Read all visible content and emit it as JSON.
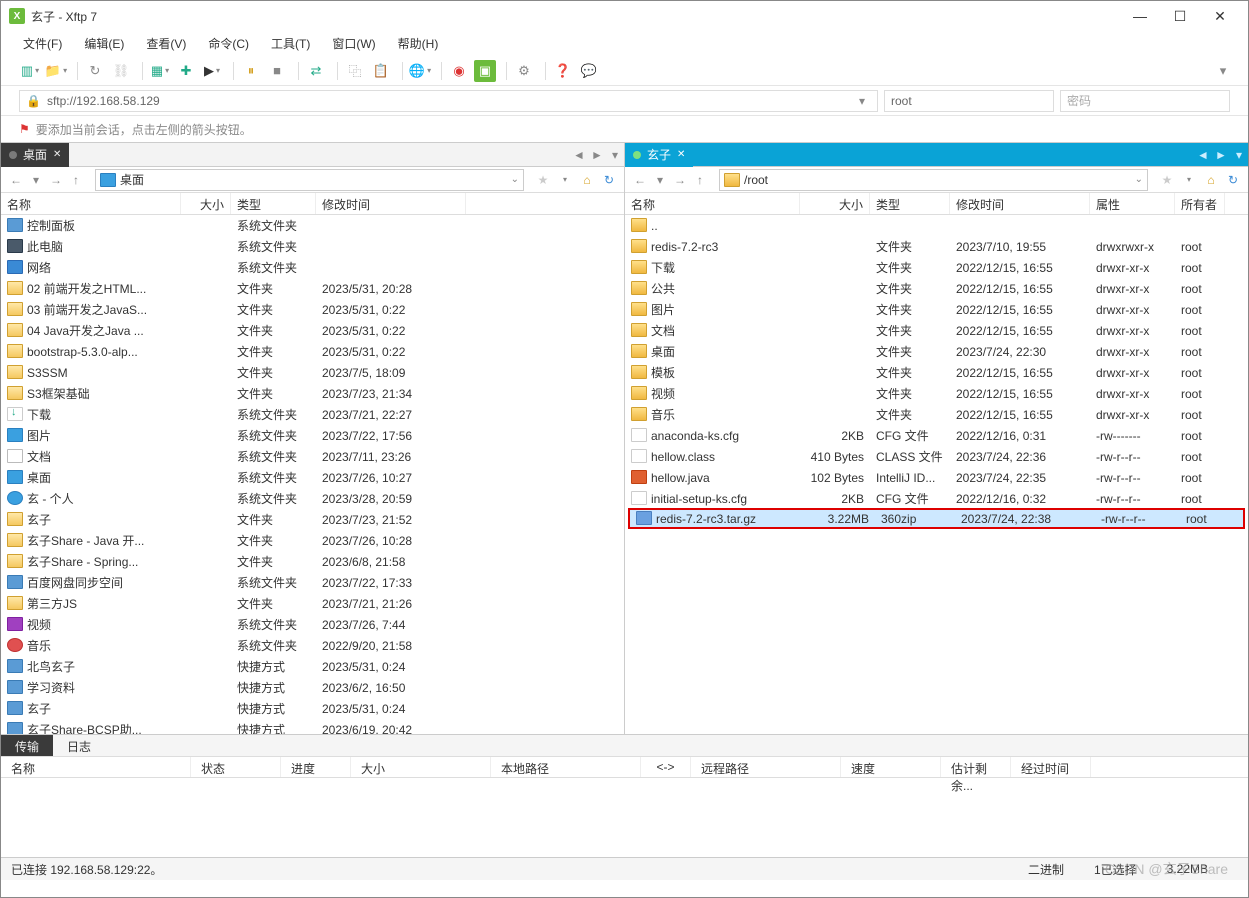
{
  "window": {
    "title": "玄子 - Xftp 7"
  },
  "menu": [
    "文件(F)",
    "编辑(E)",
    "查看(V)",
    "命令(C)",
    "工具(T)",
    "窗口(W)",
    "帮助(H)"
  ],
  "address": {
    "url": "sftp://192.168.58.129",
    "user": "root",
    "password_placeholder": "密码"
  },
  "hint": "要添加当前会话，点击左侧的箭头按钮。",
  "leftTab": "桌面",
  "rightTab": "玄子",
  "leftPath": "桌面",
  "rightPath": "/root",
  "colsLeft": {
    "name": "名称",
    "size": "大小",
    "type": "类型",
    "date": "修改时间"
  },
  "colsRight": {
    "name": "名称",
    "size": "大小",
    "type": "类型",
    "date": "修改时间",
    "attr": "属性",
    "own": "所有者"
  },
  "leftRows": [
    {
      "ic": "ic-sys",
      "n": "控制面板",
      "t": "系统文件夹",
      "d": ""
    },
    {
      "ic": "ic-pc",
      "n": "此电脑",
      "t": "系统文件夹",
      "d": ""
    },
    {
      "ic": "ic-net",
      "n": "网络",
      "t": "系统文件夹",
      "d": ""
    },
    {
      "ic": "ic-lfolder",
      "n": "02 前端开发之HTML...",
      "t": "文件夹",
      "d": "2023/5/31, 20:28"
    },
    {
      "ic": "ic-lfolder",
      "n": "03 前端开发之JavaS...",
      "t": "文件夹",
      "d": "2023/5/31, 0:22"
    },
    {
      "ic": "ic-lfolder",
      "n": "04 Java开发之Java ...",
      "t": "文件夹",
      "d": "2023/5/31, 0:22"
    },
    {
      "ic": "ic-lfolder",
      "n": "bootstrap-5.3.0-alp...",
      "t": "文件夹",
      "d": "2023/5/31, 0:22"
    },
    {
      "ic": "ic-lfolder",
      "n": "S3SSM",
      "t": "文件夹",
      "d": "2023/7/5, 18:09"
    },
    {
      "ic": "ic-lfolder",
      "n": "S3框架基础",
      "t": "文件夹",
      "d": "2023/7/23, 21:34"
    },
    {
      "ic": "ic-dl",
      "n": "下载",
      "t": "系统文件夹",
      "d": "2023/7/21, 22:27"
    },
    {
      "ic": "ic-img",
      "n": "图片",
      "t": "系统文件夹",
      "d": "2023/7/22, 17:56"
    },
    {
      "ic": "ic-doc",
      "n": "文档",
      "t": "系统文件夹",
      "d": "2023/7/11, 23:26"
    },
    {
      "ic": "ic-desktop",
      "n": "桌面",
      "t": "系统文件夹",
      "d": "2023/7/26, 10:27"
    },
    {
      "ic": "ic-cloud",
      "n": "玄 - 个人",
      "t": "系统文件夹",
      "d": "2023/3/28, 20:59"
    },
    {
      "ic": "ic-lfolder",
      "n": "玄子",
      "t": "文件夹",
      "d": "2023/7/23, 21:52"
    },
    {
      "ic": "ic-lfolder",
      "n": "玄子Share - Java 开...",
      "t": "文件夹",
      "d": "2023/7/26, 10:28"
    },
    {
      "ic": "ic-lfolder",
      "n": "玄子Share - Spring...",
      "t": "文件夹",
      "d": "2023/6/8, 21:58"
    },
    {
      "ic": "ic-sys",
      "n": "百度网盘同步空间",
      "t": "系统文件夹",
      "d": "2023/7/22, 17:33"
    },
    {
      "ic": "ic-lfolder",
      "n": "第三方JS",
      "t": "文件夹",
      "d": "2023/7/21, 21:26"
    },
    {
      "ic": "ic-video",
      "n": "视频",
      "t": "系统文件夹",
      "d": "2023/7/26, 7:44"
    },
    {
      "ic": "ic-music",
      "n": "音乐",
      "t": "系统文件夹",
      "d": "2022/9/20, 21:58"
    },
    {
      "ic": "ic-link",
      "n": "北鸟玄子",
      "t": "快捷方式",
      "d": "2023/5/31, 0:24"
    },
    {
      "ic": "ic-link",
      "n": "学习资料",
      "t": "快捷方式",
      "d": "2023/6/2, 16:50"
    },
    {
      "ic": "ic-link",
      "n": "玄子",
      "t": "快捷方式",
      "d": "2023/5/31, 0:24"
    },
    {
      "ic": "ic-link",
      "n": "玄子Share-BCSP助...",
      "t": "快捷方式",
      "d": "2023/6/19, 20:42"
    }
  ],
  "rightRows": [
    {
      "ic": "ic-folder",
      "n": "..",
      "s": "",
      "t": "",
      "d": "",
      "a": "",
      "o": ""
    },
    {
      "ic": "ic-folder",
      "n": "redis-7.2-rc3",
      "s": "",
      "t": "文件夹",
      "d": "2023/7/10, 19:55",
      "a": "drwxrwxr-x",
      "o": "root"
    },
    {
      "ic": "ic-folder",
      "n": "下载",
      "s": "",
      "t": "文件夹",
      "d": "2022/12/15, 16:55",
      "a": "drwxr-xr-x",
      "o": "root"
    },
    {
      "ic": "ic-folder",
      "n": "公共",
      "s": "",
      "t": "文件夹",
      "d": "2022/12/15, 16:55",
      "a": "drwxr-xr-x",
      "o": "root"
    },
    {
      "ic": "ic-folder",
      "n": "图片",
      "s": "",
      "t": "文件夹",
      "d": "2022/12/15, 16:55",
      "a": "drwxr-xr-x",
      "o": "root"
    },
    {
      "ic": "ic-folder",
      "n": "文档",
      "s": "",
      "t": "文件夹",
      "d": "2022/12/15, 16:55",
      "a": "drwxr-xr-x",
      "o": "root"
    },
    {
      "ic": "ic-folder",
      "n": "桌面",
      "s": "",
      "t": "文件夹",
      "d": "2023/7/24, 22:30",
      "a": "drwxr-xr-x",
      "o": "root"
    },
    {
      "ic": "ic-folder",
      "n": "模板",
      "s": "",
      "t": "文件夹",
      "d": "2022/12/15, 16:55",
      "a": "drwxr-xr-x",
      "o": "root"
    },
    {
      "ic": "ic-folder",
      "n": "视频",
      "s": "",
      "t": "文件夹",
      "d": "2022/12/15, 16:55",
      "a": "drwxr-xr-x",
      "o": "root"
    },
    {
      "ic": "ic-folder",
      "n": "音乐",
      "s": "",
      "t": "文件夹",
      "d": "2022/12/15, 16:55",
      "a": "drwxr-xr-x",
      "o": "root"
    },
    {
      "ic": "ic-file",
      "n": "anaconda-ks.cfg",
      "s": "2KB",
      "t": "CFG 文件",
      "d": "2022/12/16, 0:31",
      "a": "-rw-------",
      "o": "root"
    },
    {
      "ic": "ic-file",
      "n": "hellow.class",
      "s": "410 Bytes",
      "t": "CLASS 文件",
      "d": "2023/7/24, 22:36",
      "a": "-rw-r--r--",
      "o": "root"
    },
    {
      "ic": "ic-java",
      "n": "hellow.java",
      "s": "102 Bytes",
      "t": "IntelliJ ID...",
      "d": "2023/7/24, 22:35",
      "a": "-rw-r--r--",
      "o": "root"
    },
    {
      "ic": "ic-file",
      "n": "initial-setup-ks.cfg",
      "s": "2KB",
      "t": "CFG 文件",
      "d": "2022/12/16, 0:32",
      "a": "-rw-r--r--",
      "o": "root"
    },
    {
      "ic": "ic-zip",
      "n": "redis-7.2-rc3.tar.gz",
      "s": "3.22MB",
      "t": "360zip",
      "d": "2023/7/24, 22:38",
      "a": "-rw-r--r--",
      "o": "root",
      "sel": true
    }
  ],
  "logTabs": [
    "传输",
    "日志"
  ],
  "xferCols": {
    "name": "名称",
    "status": "状态",
    "prog": "进度",
    "size": "大小",
    "lpath": "本地路径",
    "arrow": "<->",
    "rpath": "远程路径",
    "speed": "速度",
    "eta": "估计剩余...",
    "elapsed": "经过时间"
  },
  "status": {
    "conn": "已连接 192.168.58.129:22。",
    "bin": "二进制",
    "sel": "1已选择",
    "sz": "3.22MB"
  },
  "watermark": "CSDN @玄子Share"
}
